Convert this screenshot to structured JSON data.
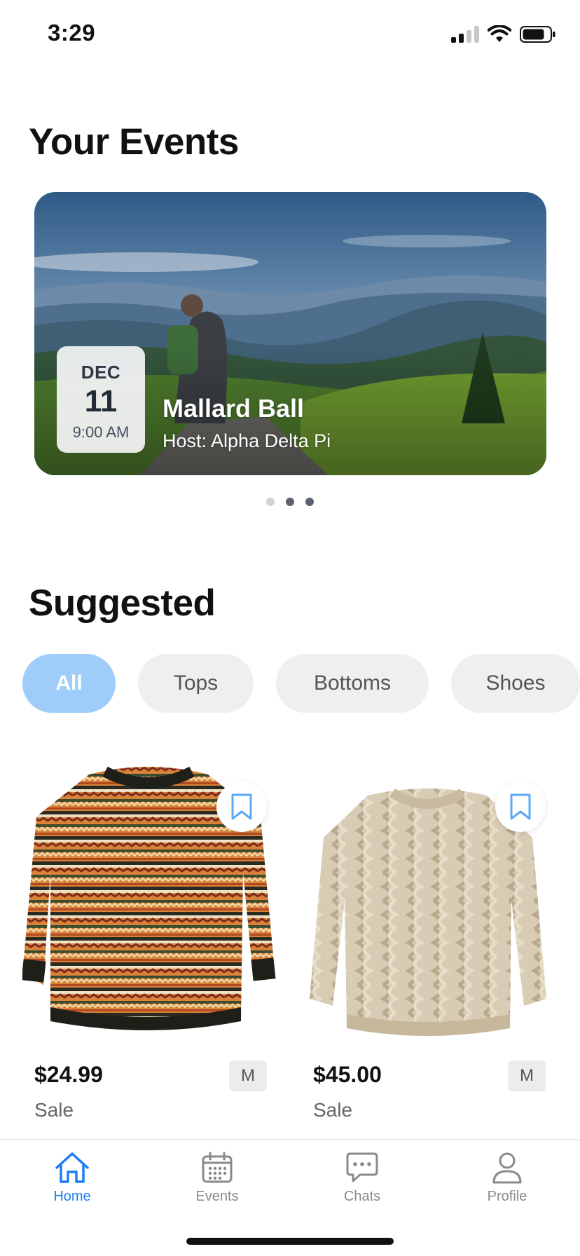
{
  "status_bar": {
    "time": "3:29"
  },
  "events_section": {
    "title": "Your Events",
    "event": {
      "month": "DEC",
      "day": "11",
      "time": "9:00 AM",
      "title": "Mallard Ball",
      "host": "Host: Alpha Delta Pi"
    },
    "pager": {
      "count": 3,
      "active_index": 1
    }
  },
  "suggested_section": {
    "title": "Suggested",
    "filters": [
      {
        "label": "All",
        "active": true
      },
      {
        "label": "Tops",
        "active": false
      },
      {
        "label": "Bottoms",
        "active": false
      },
      {
        "label": "Shoes",
        "active": false
      }
    ],
    "products": [
      {
        "price": "$24.99",
        "size": "M",
        "status": "Sale"
      },
      {
        "price": "$45.00",
        "size": "M",
        "status": "Sale"
      }
    ]
  },
  "tab_bar": {
    "tabs": [
      {
        "label": "Home",
        "icon": "home-icon",
        "active": true
      },
      {
        "label": "Events",
        "icon": "calendar-icon",
        "active": false
      },
      {
        "label": "Chats",
        "icon": "chat-bubble-icon",
        "active": false
      },
      {
        "label": "Profile",
        "icon": "person-icon",
        "active": false
      }
    ]
  },
  "colors": {
    "accent": "#1a7ef5",
    "chip_active": "#9fcdfa",
    "chip_inactive": "#efefef",
    "bookmark": "#5aa9f6"
  }
}
